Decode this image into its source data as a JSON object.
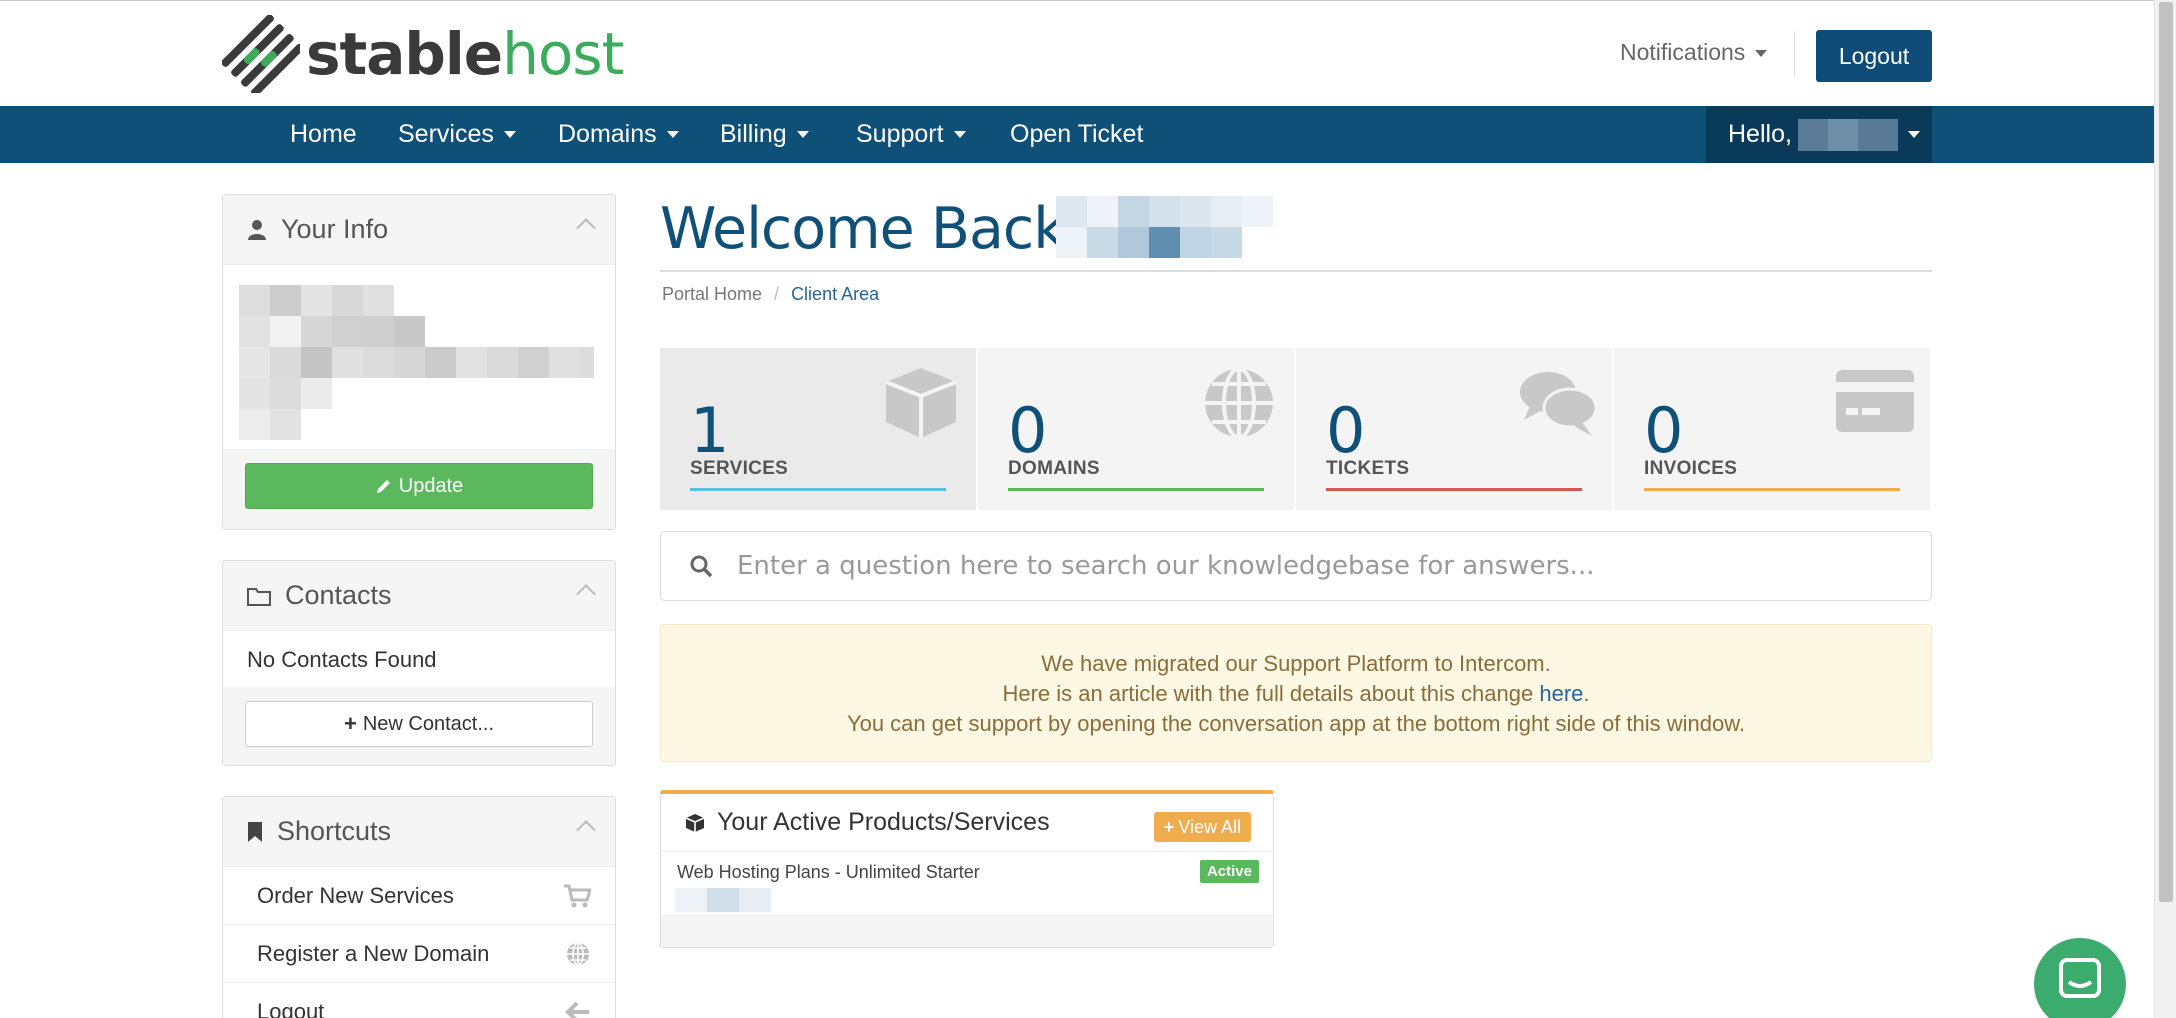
{
  "brand": {
    "logo_part1": "stable",
    "logo_part2": "host"
  },
  "header": {
    "notifications_label": "Notifications",
    "logout_label": "Logout"
  },
  "nav": {
    "items": [
      {
        "label": "Home"
      },
      {
        "label": "Services"
      },
      {
        "label": "Domains"
      },
      {
        "label": "Billing"
      },
      {
        "label": "Support"
      },
      {
        "label": "Open Ticket"
      }
    ],
    "hello_label": "Hello,"
  },
  "sidebar": {
    "your_info": {
      "title": "Your Info",
      "update_label": "Update"
    },
    "contacts": {
      "title": "Contacts",
      "empty_text": "No Contacts Found",
      "new_contact_label": "New Contact..."
    },
    "shortcuts": {
      "title": "Shortcuts",
      "items": [
        {
          "label": "Order New Services",
          "icon": "cart-icon"
        },
        {
          "label": "Register a New Domain",
          "icon": "globe-icon"
        },
        {
          "label": "Logout",
          "icon": "arrow-left-icon"
        }
      ]
    }
  },
  "main": {
    "welcome": "Welcome Back,",
    "breadcrumb": {
      "home": "Portal Home",
      "separator": "/",
      "current": "Client Area"
    },
    "tiles": [
      {
        "count": "1",
        "label": "SERVICES",
        "color": "#5bc0de",
        "icon": "cube-icon"
      },
      {
        "count": "0",
        "label": "DOMAINS",
        "color": "#5cb85c",
        "icon": "globe-icon"
      },
      {
        "count": "0",
        "label": "TICKETS",
        "color": "#d9534f",
        "icon": "comments-icon"
      },
      {
        "count": "0",
        "label": "INVOICES",
        "color": "#f0ad4e",
        "icon": "credit-card-icon"
      }
    ],
    "search": {
      "placeholder": "Enter a question here to search our knowledgebase for answers..."
    },
    "alert": {
      "line1": "We have migrated our Support Platform to Intercom.",
      "line2_before": "Here is an article with the full details about this change ",
      "line2_link": "here",
      "line2_after": ".",
      "line3": "You can get support by opening the conversation app at the bottom right side of this window."
    },
    "products": {
      "title": "Your Active Products/Services",
      "view_all_label": "View All",
      "rows": [
        {
          "name": "Web Hosting Plans - Unlimited Starter",
          "status": "Active"
        }
      ]
    }
  },
  "colors": {
    "primary": "#0f5079",
    "success": "#5cb85c",
    "warning": "#f0ad4e",
    "danger": "#d9534f",
    "info": "#5bc0de"
  }
}
